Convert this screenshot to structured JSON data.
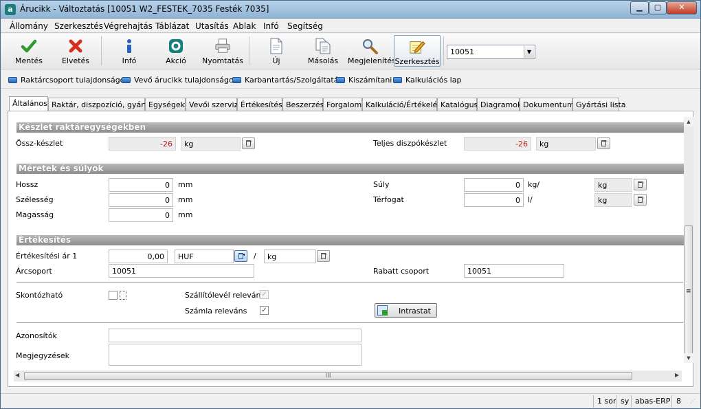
{
  "window": {
    "title": "Árucikk - Változtatás  [10051  W2_FESTEK_7035   Festék 7035]",
    "app_icon": "a",
    "minimize_glyph": "▁",
    "maximize_glyph": "▢",
    "close_glyph": "✕"
  },
  "menu": [
    "Állomány",
    "Szerkesztés",
    "Végrehajtás",
    "Táblázat",
    "Utasítás",
    "Ablak",
    "Infó",
    "Segítség"
  ],
  "toolbar": {
    "save": "Mentés",
    "discard": "Elvetés",
    "info": "Infó",
    "action": "Akció",
    "print": "Nyomtatás",
    "new": "Új",
    "copy": "Másolás",
    "view": "Megjelenítés",
    "edit": "Szerkesztés",
    "search_value": "10051",
    "combo_arrow": "▼"
  },
  "quicklinks": [
    "Raktárcsoport tulajdonságok",
    "Vevő árucikk tulajdonságok",
    "Karbantartás/Szolgáltatás",
    "Kiszámítani",
    "Kalkulációs lap"
  ],
  "tabs": [
    "Általános",
    "Raktár, diszpozíció, gyártás",
    "Egységek",
    "Vevői szerviz",
    "Értékesítés",
    "Beszerzés",
    "Forgalom",
    "Kalkuláció/Értékelés",
    "Katalógus",
    "Diagramok",
    "Dokumentum",
    "Gyártási lista"
  ],
  "section_stock": {
    "title": "Készlet raktáregységekben",
    "total_label": "Össz-készlet",
    "total_value": "-26",
    "total_unit": "kg",
    "dispo_label": "Teljes diszpókészlet",
    "dispo_value": "-26",
    "dispo_unit": "kg"
  },
  "section_dims": {
    "title": "Méretek és súlyok",
    "length_label": "Hossz",
    "length_value": "0",
    "length_unit": "mm",
    "width_label": "Szélesség",
    "width_value": "0",
    "width_unit": "mm",
    "height_label": "Magasság",
    "height_value": "0",
    "height_unit": "mm",
    "weight_label": "Súly",
    "weight_value": "0",
    "weight_unit": "kg/",
    "weight_ref_unit": "kg",
    "volume_label": "Térfogat",
    "volume_value": "0",
    "volume_unit": "l/",
    "volume_ref_unit": "kg"
  },
  "section_sales": {
    "title": "Értékesítés",
    "price_label": "Értékesítési ár 1",
    "price_value": "0,00",
    "currency": "HUF",
    "slash": "/",
    "per_unit": "kg",
    "price_group_label": "Árcsoport",
    "price_group_value": "10051",
    "discount_group_label": "Rabatt csoport",
    "discount_group_value": "10051",
    "discountable_label": "Skontózható",
    "delivery_note_label": "Szállítólevél releváns",
    "delivery_note_checked": true,
    "invoice_label": "Számla releváns",
    "invoice_checked": true,
    "check_glyph": "✓",
    "intrastat_button": "Intrastat"
  },
  "section_misc": {
    "identifiers_label": "Azonosítók",
    "identifiers_value": "",
    "notes_label": "Megjegyzések",
    "notes_value": ""
  },
  "scroll": {
    "up": "▲",
    "down": "▼",
    "left": "◀",
    "right": "▶",
    "grip_v": "≡",
    "grip_h": "III"
  },
  "status": {
    "rows": "1 sor",
    "user": "sy",
    "app": "abas-ERP",
    "number": "8"
  }
}
